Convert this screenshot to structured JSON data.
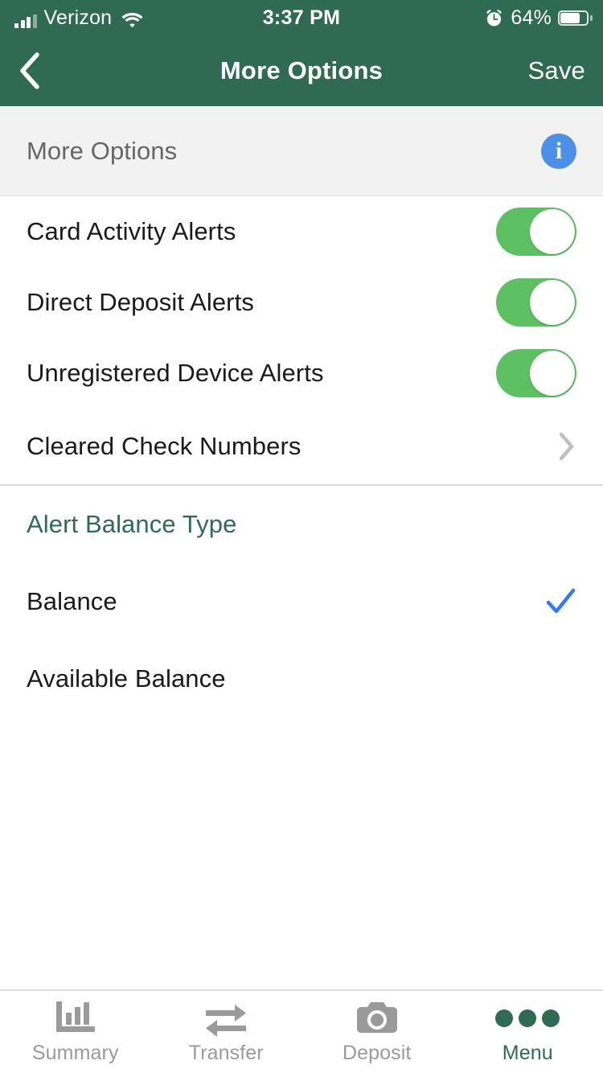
{
  "status_bar": {
    "carrier": "Verizon",
    "time": "3:37 PM",
    "battery_percent": "64%",
    "signal_bars_filled": 3,
    "signal_bars_total": 4,
    "icons": [
      "signal-icon",
      "wifi-icon",
      "alarm-clock-icon",
      "battery-icon"
    ]
  },
  "nav_bar": {
    "back_label": "",
    "title": "More Options",
    "save_label": "Save",
    "background_color": "#2E6B52"
  },
  "section_header": {
    "title": "More Options",
    "info_glyph": "i",
    "info_color": "#4A90E8",
    "background_color": "#F2F2F2"
  },
  "settings": {
    "rows": [
      {
        "label": "Card Activity Alerts",
        "control": "toggle",
        "value": "on"
      },
      {
        "label": "Direct Deposit Alerts",
        "control": "toggle",
        "value": "on"
      },
      {
        "label": "Unregistered Device Alerts",
        "control": "toggle",
        "value": "on"
      },
      {
        "label": "Cleared Check Numbers",
        "control": "chevron",
        "value": ""
      }
    ]
  },
  "alert_balance_type": {
    "group_label": "Alert Balance Type",
    "group_label_color": "#2E6B52",
    "options": [
      {
        "label": "Balance",
        "selected": true
      },
      {
        "label": "Available Balance",
        "selected": false
      }
    ],
    "check_color": "#3478F6"
  },
  "tab_bar": {
    "tabs": [
      {
        "label": "Summary",
        "icon": "bar-chart-icon",
        "active": false
      },
      {
        "label": "Transfer",
        "icon": "transfer-arrows-icon",
        "active": false
      },
      {
        "label": "Deposit",
        "icon": "camera-icon",
        "active": false
      },
      {
        "label": "Menu",
        "icon": "three-dots-icon",
        "active": true
      }
    ],
    "active_color": "#2E6B52",
    "inactive_color": "#9A9A9A"
  },
  "theme": {
    "brand_green": "#2E6B52",
    "toggle_on_green": "#5DC163",
    "info_blue": "#4A90E8",
    "check_blue": "#3478F6"
  }
}
